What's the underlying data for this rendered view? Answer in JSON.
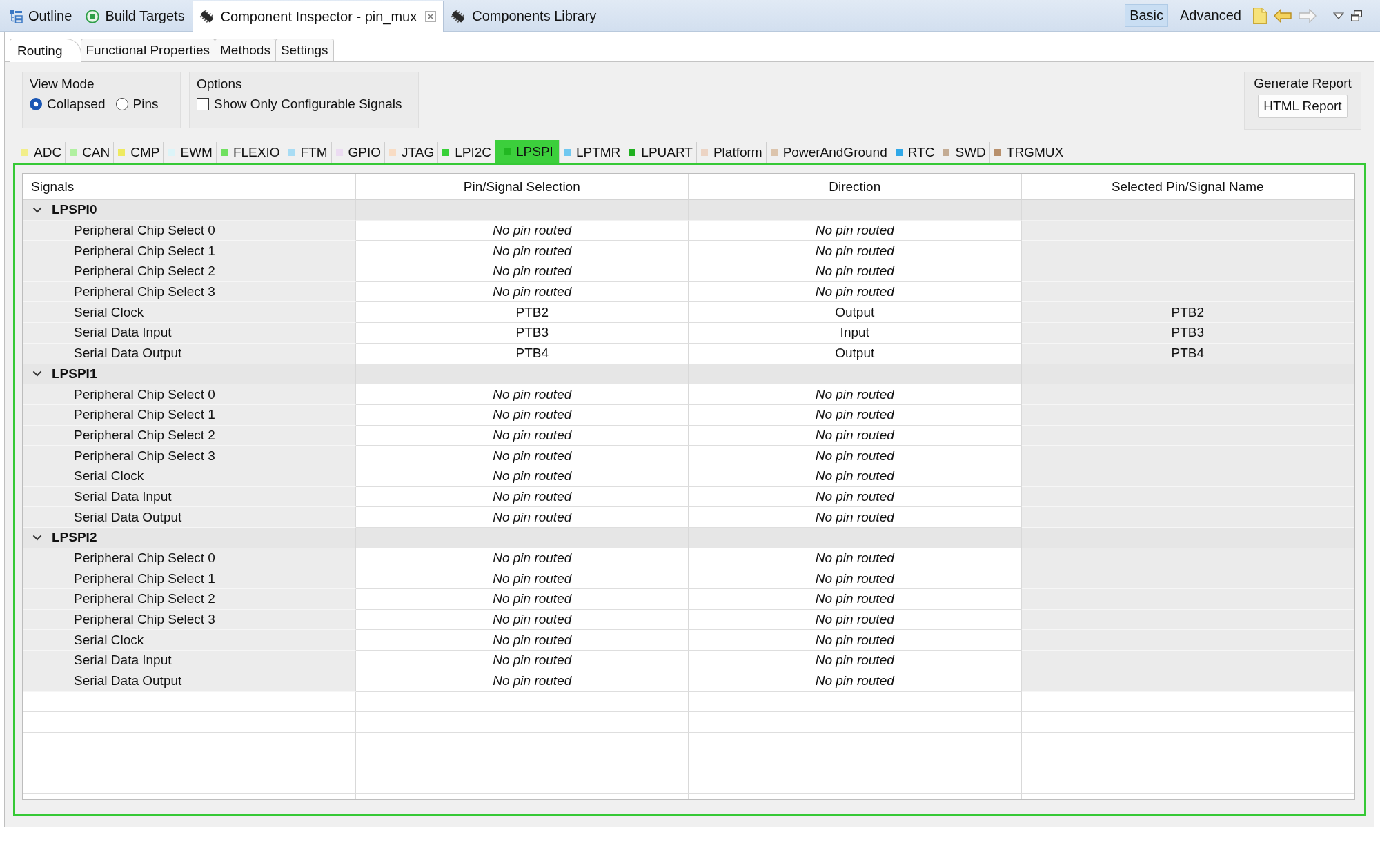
{
  "view_tabs": [
    {
      "label": "Outline",
      "selected": false
    },
    {
      "label": "Build Targets",
      "selected": false
    },
    {
      "label": "Component Inspector - pin_mux",
      "selected": true
    },
    {
      "label": "Components Library",
      "selected": false
    }
  ],
  "mode_buttons": [
    {
      "label": "Basic",
      "selected": true
    },
    {
      "label": "Advanced",
      "selected": false
    }
  ],
  "nav_buttons": [
    {
      "kind": "back",
      "disabled": false
    },
    {
      "kind": "forward",
      "disabled": true
    }
  ],
  "editor_tabs": [
    {
      "label": "Routing",
      "selected": true
    },
    {
      "label": "Functional Properties",
      "selected": false
    },
    {
      "label": "Methods",
      "selected": false
    },
    {
      "label": "Settings",
      "selected": false
    }
  ],
  "view_mode": {
    "title": "View Mode",
    "options": [
      {
        "label": "Collapsed",
        "selected": true
      },
      {
        "label": "Pins",
        "selected": false
      }
    ]
  },
  "options": {
    "title": "Options",
    "checkboxes": [
      {
        "label": "Show Only Configurable Signals",
        "checked": false
      }
    ]
  },
  "generate_report": {
    "title": "Generate Report",
    "button": "HTML Report"
  },
  "peripheral_tabs": [
    {
      "label": "ADC",
      "color": "#f2ee8a",
      "selected": false
    },
    {
      "label": "CAN",
      "color": "#b0f0a0",
      "selected": false
    },
    {
      "label": "CMP",
      "color": "#eeea60",
      "selected": false
    },
    {
      "label": "EWM",
      "color": "#dcf4f8",
      "selected": false
    },
    {
      "label": "FLEXIO",
      "color": "#70e060",
      "selected": false
    },
    {
      "label": "FTM",
      "color": "#a8dcf4",
      "selected": false
    },
    {
      "label": "GPIO",
      "color": "#ecdcf2",
      "selected": false
    },
    {
      "label": "JTAG",
      "color": "#f8dcc4",
      "selected": false
    },
    {
      "label": "LPI2C",
      "color": "#38d038",
      "selected": false
    },
    {
      "label": "LPSPI",
      "color": "#22b822",
      "selected": true
    },
    {
      "label": "LPTMR",
      "color": "#70c8f0",
      "selected": false
    },
    {
      "label": "LPUART",
      "color": "#20b020",
      "selected": false
    },
    {
      "label": "Platform",
      "color": "#ecd4c4",
      "selected": false
    },
    {
      "label": "PowerAndGround",
      "color": "#dcc4ac",
      "selected": false
    },
    {
      "label": "RTC",
      "color": "#30a8e8",
      "selected": false
    },
    {
      "label": "SWD",
      "color": "#c4ac94",
      "selected": false
    },
    {
      "label": "TRGMUX",
      "color": "#b8906c",
      "selected": false
    }
  ],
  "table": {
    "columns": [
      "Signals",
      "Pin/Signal Selection",
      "Direction",
      "Selected Pin/Signal Name"
    ],
    "groups": [
      {
        "name": "LPSPI0",
        "expanded": true,
        "children": [
          {
            "signal": "Peripheral Chip Select 0",
            "pin_selection": "No pin routed",
            "direction": "No pin routed",
            "routed": false
          },
          {
            "signal": "Peripheral Chip Select 1",
            "pin_selection": "No pin routed",
            "direction": "No pin routed",
            "routed": false
          },
          {
            "signal": "Peripheral Chip Select 2",
            "pin_selection": "No pin routed",
            "direction": "No pin routed",
            "routed": false
          },
          {
            "signal": "Peripheral Chip Select 3",
            "pin_selection": "No pin routed",
            "direction": "No pin routed",
            "routed": false
          },
          {
            "signal": "Serial Clock",
            "pin_selection": "PTB2",
            "direction": "Output",
            "selected_pin": "PTB2",
            "routed": true
          },
          {
            "signal": "Serial Data Input",
            "pin_selection": "PTB3",
            "direction": "Input",
            "selected_pin": "PTB3",
            "routed": true
          },
          {
            "signal": "Serial Data Output",
            "pin_selection": "PTB4",
            "direction": "Output",
            "selected_pin": "PTB4",
            "routed": true
          }
        ]
      },
      {
        "name": "LPSPI1",
        "expanded": true,
        "children": [
          {
            "signal": "Peripheral Chip Select 0",
            "pin_selection": "No pin routed",
            "direction": "No pin routed",
            "routed": false
          },
          {
            "signal": "Peripheral Chip Select 1",
            "pin_selection": "No pin routed",
            "direction": "No pin routed",
            "routed": false
          },
          {
            "signal": "Peripheral Chip Select 2",
            "pin_selection": "No pin routed",
            "direction": "No pin routed",
            "routed": false
          },
          {
            "signal": "Peripheral Chip Select 3",
            "pin_selection": "No pin routed",
            "direction": "No pin routed",
            "routed": false
          },
          {
            "signal": "Serial Clock",
            "pin_selection": "No pin routed",
            "direction": "No pin routed",
            "routed": false
          },
          {
            "signal": "Serial Data Input",
            "pin_selection": "No pin routed",
            "direction": "No pin routed",
            "routed": false
          },
          {
            "signal": "Serial Data Output",
            "pin_selection": "No pin routed",
            "direction": "No pin routed",
            "routed": false
          }
        ]
      },
      {
        "name": "LPSPI2",
        "expanded": true,
        "children": [
          {
            "signal": "Peripheral Chip Select 0",
            "pin_selection": "No pin routed",
            "direction": "No pin routed",
            "routed": false
          },
          {
            "signal": "Peripheral Chip Select 1",
            "pin_selection": "No pin routed",
            "direction": "No pin routed",
            "routed": false
          },
          {
            "signal": "Peripheral Chip Select 2",
            "pin_selection": "No pin routed",
            "direction": "No pin routed",
            "routed": false
          },
          {
            "signal": "Peripheral Chip Select 3",
            "pin_selection": "No pin routed",
            "direction": "No pin routed",
            "routed": false
          },
          {
            "signal": "Serial Clock",
            "pin_selection": "No pin routed",
            "direction": "No pin routed",
            "routed": false
          },
          {
            "signal": "Serial Data Input",
            "pin_selection": "No pin routed",
            "direction": "No pin routed",
            "routed": false
          },
          {
            "signal": "Serial Data Output",
            "pin_selection": "No pin routed",
            "direction": "No pin routed",
            "routed": false
          }
        ]
      }
    ]
  }
}
